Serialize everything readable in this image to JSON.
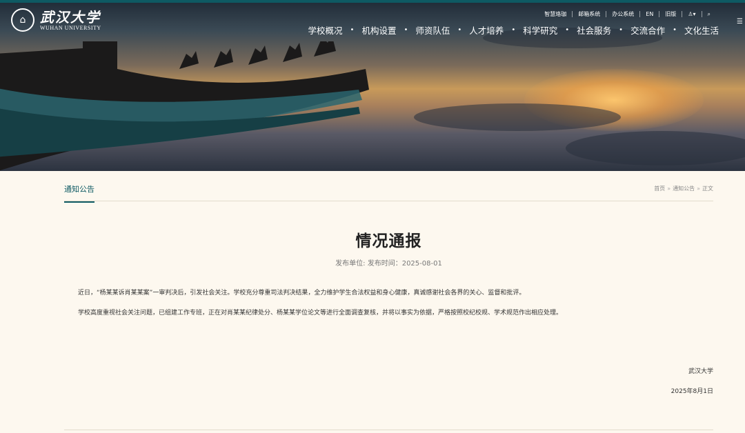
{
  "header": {
    "logo_cn": "武汉大学",
    "logo_en": "WUHAN UNIVERSITY",
    "utility_links": [
      "智慧珞珈",
      "邮箱系统",
      "办公系统",
      "EN",
      "旧版"
    ],
    "main_nav": [
      "学校概况",
      "机构设置",
      "师资队伍",
      "人才培养",
      "科学研究",
      "社会服务",
      "交流合作",
      "文化生活"
    ]
  },
  "section": {
    "tab": "通知公告",
    "breadcrumb": [
      "首页",
      "通知公告",
      "正文"
    ],
    "breadcrumb_sep": "»"
  },
  "article": {
    "title": "情况通报",
    "meta": "发布单位: 发布时间：2025-08-01",
    "paragraphs": [
      "近日，“杨某某诉肖某某案”一审判决后，引发社会关注。学校充分尊重司法判决结果，全力维护学生合法权益和身心健康，真诚感谢社会各界的关心、监督和批评。",
      "学校高度重视社会关注问题，已组建工作专班，正在对肖某某纪律处分、杨某某学位论文等进行全面调查复核，并将以事实为依据，严格按照校纪校规、学术规范作出相应处理。"
    ],
    "signature_org": "武汉大学",
    "signature_date": "2025年8月1日"
  },
  "colors": {
    "accent": "#0e5a63",
    "background": "#fdf8ef"
  }
}
